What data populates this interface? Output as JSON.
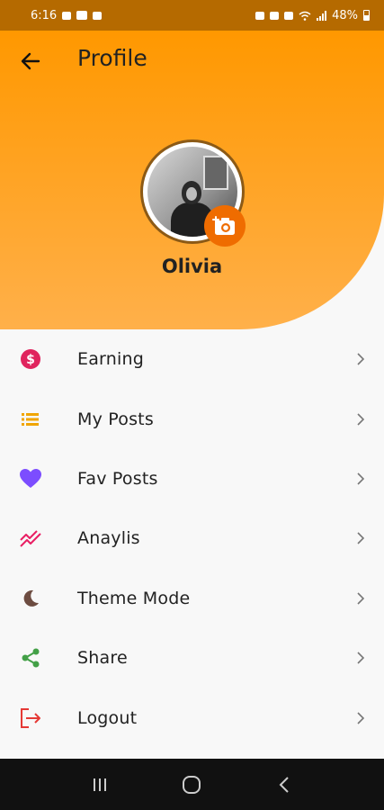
{
  "status_bar": {
    "time": "6:16",
    "battery": "48%"
  },
  "header": {
    "title": "Profile",
    "back_icon": "arrow-left-icon",
    "background": "#ff9800"
  },
  "profile": {
    "name": "Olivia",
    "camera_icon": "add-photo-icon",
    "camera_color": "#ef6c00"
  },
  "menu": {
    "items": [
      {
        "label": "Earning",
        "icon": "dollar-circle-icon",
        "color": "#e0245e"
      },
      {
        "label": "My Posts",
        "icon": "list-icon",
        "color": "#f0a500"
      },
      {
        "label": "Fav Posts",
        "icon": "heart-icon",
        "color": "#7c4dff"
      },
      {
        "label": "Anaylis",
        "icon": "trending-icon",
        "color": "#e91e63"
      },
      {
        "label": "Theme Mode",
        "icon": "moon-icon",
        "color": "#6d4c41"
      },
      {
        "label": "Share",
        "icon": "share-icon",
        "color": "#43a047"
      },
      {
        "label": "Logout",
        "icon": "logout-icon",
        "color": "#e53935"
      }
    ]
  },
  "nav_bar": {
    "buttons": [
      "recents-icon",
      "home-icon",
      "back-icon"
    ]
  }
}
